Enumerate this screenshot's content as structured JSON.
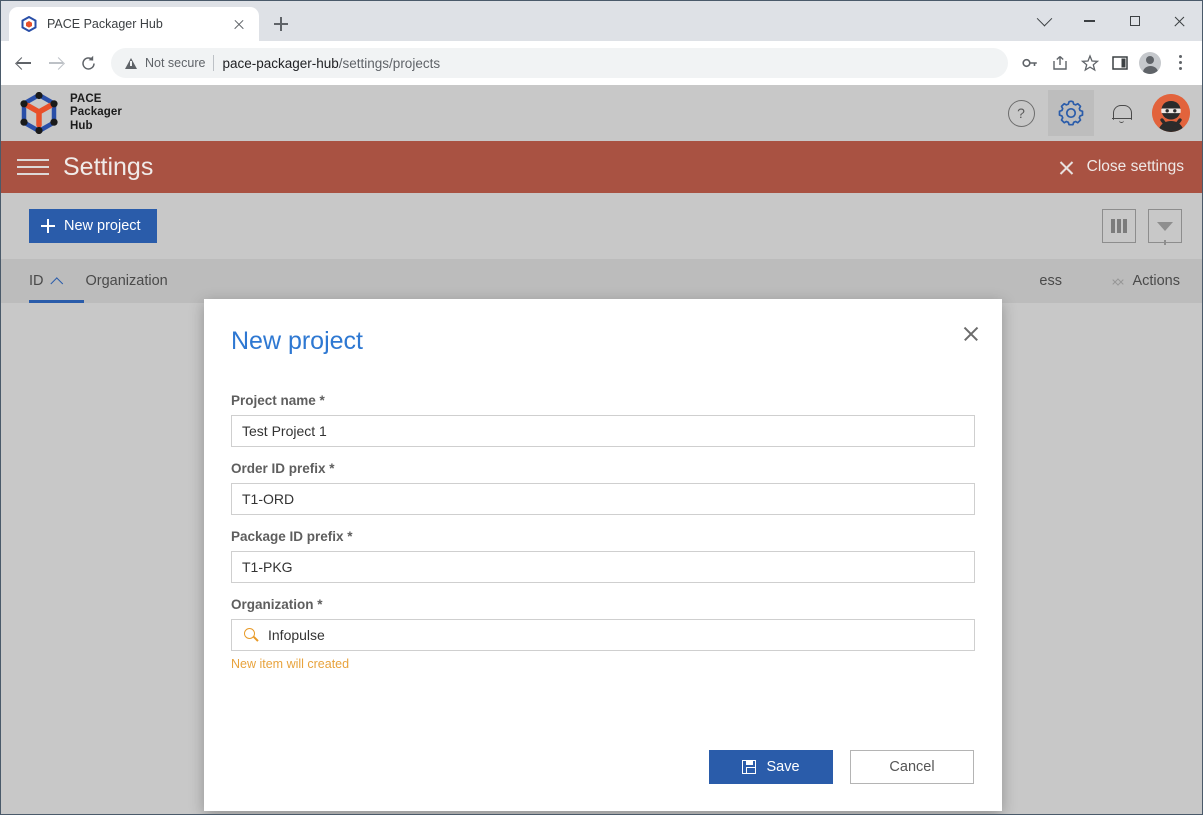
{
  "browser": {
    "tab": {
      "title": "PACE Packager Hub",
      "favicon": "pace-cube-icon",
      "close": "close-tab-icon"
    },
    "new_tab": "new-tab-icon",
    "window_controls": [
      "chevron-down-icon",
      "minimize-icon",
      "maximize-icon",
      "close-window-icon"
    ],
    "nav": {
      "back": "back-arrow-icon",
      "forward": "forward-arrow-icon",
      "reload": "reload-icon"
    },
    "omnibox": {
      "security_icon": "not-secure-warning-icon",
      "security_label": "Not secure",
      "url_host": "pace-packager-hub",
      "url_path": "/settings/projects"
    },
    "omni_actions": [
      "password-key-icon",
      "share-icon",
      "bookmark-star-icon",
      "side-panel-icon",
      "profile-avatar-icon",
      "chrome-menu-icon"
    ]
  },
  "app": {
    "brand": {
      "line1": "PACE",
      "line2": "Packager",
      "line3": "Hub",
      "logo": "pace-cube-logo"
    },
    "header_icons": [
      {
        "name": "help-icon",
        "glyph": "?"
      },
      {
        "name": "settings-gear-icon",
        "active": true
      },
      {
        "name": "notifications-bell-icon"
      },
      {
        "name": "user-avatar-ninja"
      }
    ],
    "settings_bar": {
      "menu_icon": "hamburger-menu-icon",
      "title": "Settings",
      "close_label": "Close settings",
      "close_icon": "close-x-icon"
    },
    "toolbar": {
      "new_project_label": "New project",
      "new_project_icon": "plus-icon",
      "columns_icon": "columns-icon",
      "filter_icon": "filter-funnel-icon"
    },
    "table": {
      "columns": [
        {
          "label": "ID",
          "sorted": true,
          "sort_icon": "chevron-up-icon"
        },
        {
          "label": "Organization",
          "sorted": false
        },
        {
          "label": "ess",
          "sorted": false,
          "sort_icon": "sort-diamond-icon"
        },
        {
          "label": "Actions",
          "sorted": false
        }
      ]
    }
  },
  "modal": {
    "title": "New project",
    "close_icon": "close-x-icon",
    "fields": [
      {
        "label": "Project name *",
        "value": "Test Project 1",
        "name": "project-name"
      },
      {
        "label": "Order ID prefix *",
        "value": "T1-ORD",
        "name": "order-id-prefix"
      },
      {
        "label": "Package ID prefix *",
        "value": "T1-PKG",
        "name": "package-id-prefix"
      },
      {
        "label": "Organization *",
        "value": "Infopulse",
        "name": "organization",
        "icon": "search-icon",
        "hint": "New item will created"
      }
    ],
    "save_label": "Save",
    "save_icon": "save-floppy-icon",
    "cancel_label": "Cancel"
  },
  "colors": {
    "accent_blue": "#2a5caa",
    "title_blue": "#2e78d2",
    "settings_red": "#a95242",
    "hint_orange": "#e8a33d",
    "app_bg": "#c8c8c8"
  }
}
